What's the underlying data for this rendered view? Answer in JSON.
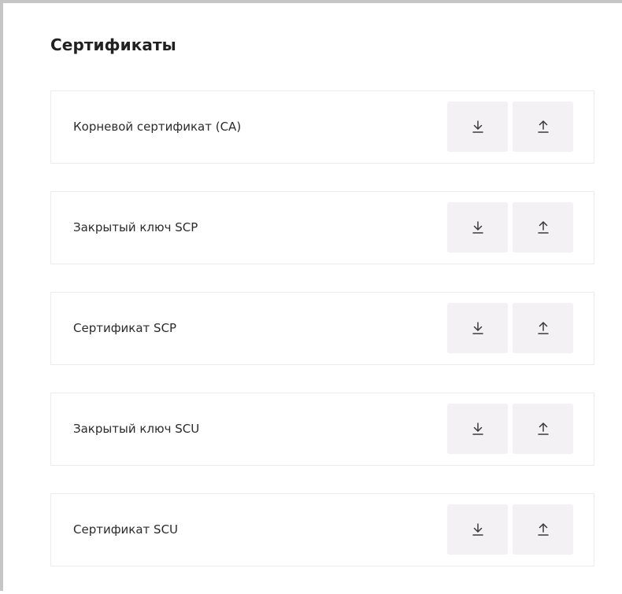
{
  "section": {
    "title": "Сертификаты"
  },
  "certificates": [
    {
      "label": "Корневой сертификат (CA)",
      "download_icon": "download-icon",
      "upload_icon": "upload-icon"
    },
    {
      "label": "Закрытый ключ SCP",
      "download_icon": "download-icon",
      "upload_icon": "upload-icon"
    },
    {
      "label": "Сертификат SCP",
      "download_icon": "download-icon",
      "upload_icon": "upload-icon"
    },
    {
      "label": "Закрытый ключ SCU",
      "download_icon": "download-icon",
      "upload_icon": "upload-icon"
    },
    {
      "label": "Сертификат SCU",
      "download_icon": "download-icon",
      "upload_icon": "upload-icon"
    }
  ],
  "colors": {
    "panel_border": "#c6c6c6",
    "card_border": "#ececec",
    "button_bg": "#f3f1f4",
    "icon": "#3a3a3a",
    "text": "#2b2b2b"
  }
}
